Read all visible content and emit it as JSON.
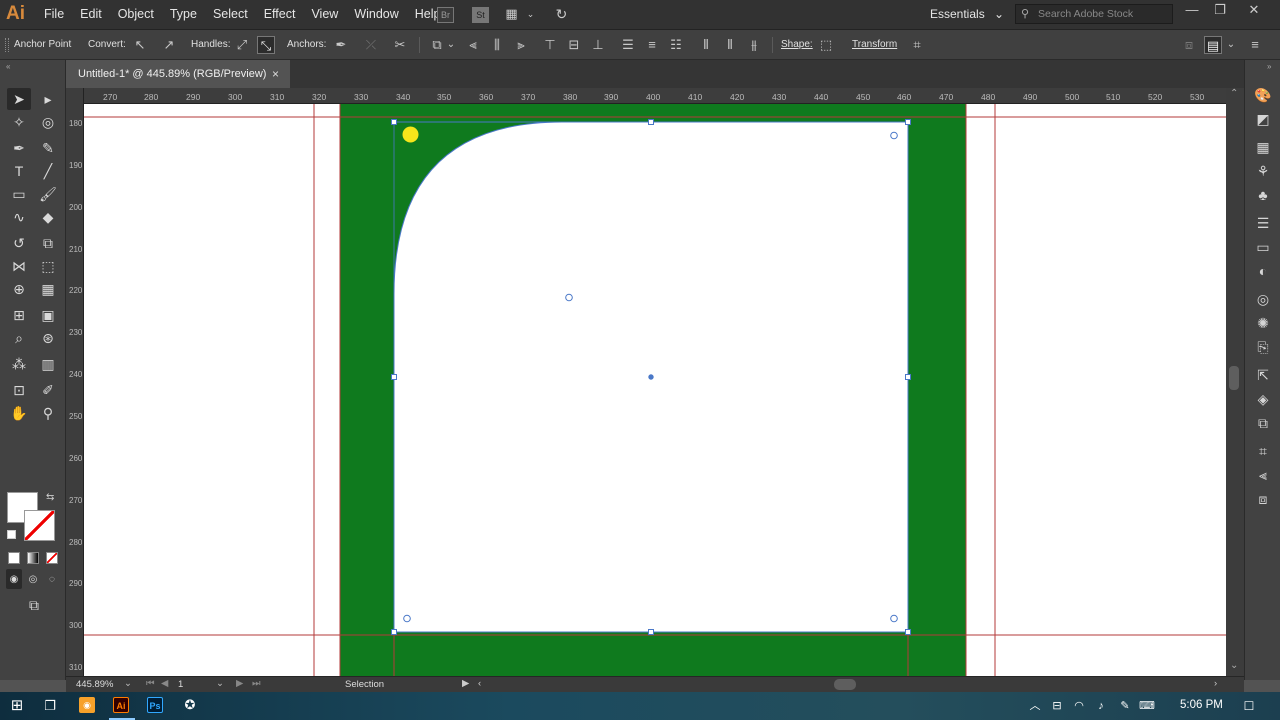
{
  "app": {
    "logo": "Ai"
  },
  "menu": [
    "File",
    "Edit",
    "Object",
    "Type",
    "Select",
    "Effect",
    "View",
    "Window",
    "Help"
  ],
  "menubar_icons": {
    "bridge": "Br",
    "stock": "St"
  },
  "workspace": {
    "label": "Essentials",
    "arrow": "⌄"
  },
  "search": {
    "placeholder": "Search Adobe Stock"
  },
  "control": {
    "anchor_point": "Anchor Point",
    "convert": "Convert:",
    "handles": "Handles:",
    "anchors": "Anchors:",
    "shape": "Shape:",
    "transform": "Transform"
  },
  "document": {
    "tab_title": "Untitled-1* @ 445.89% (RGB/Preview)",
    "close": "×"
  },
  "ruler": {
    "h_ticks": [
      "270",
      "280",
      "290",
      "300",
      "310",
      "320",
      "330",
      "340",
      "350",
      "360",
      "370",
      "380",
      "390",
      "400",
      "410",
      "420",
      "430",
      "440",
      "450",
      "460",
      "470",
      "480",
      "490",
      "500",
      "510",
      "520",
      "530"
    ],
    "v_ticks": [
      "180",
      "190",
      "200",
      "210",
      "220",
      "230",
      "240",
      "250",
      "260",
      "270",
      "280",
      "290",
      "300",
      "310"
    ]
  },
  "status": {
    "zoom": "445.89%",
    "page": "1",
    "tool": "Selection"
  },
  "taskbar": {
    "time": "5:06 PM"
  },
  "colors": {
    "artboard_green": "#0f7a1e",
    "guide_red": "#b33a3a",
    "selection_blue": "#4a78c8",
    "highlight_yellow": "#f5e51b",
    "ui_dark": "#323232"
  }
}
